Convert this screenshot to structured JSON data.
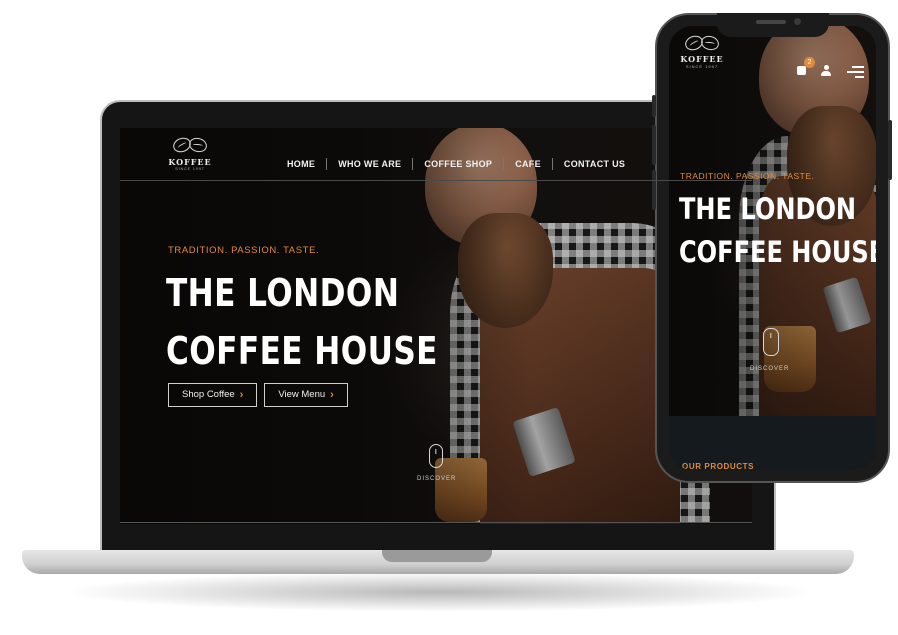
{
  "brand": {
    "name": "KOFFEE",
    "since": "SINCE 1997"
  },
  "laptop": {
    "nav": [
      "HOME",
      "WHO WE ARE",
      "COFFEE SHOP",
      "CAFE",
      "CONTACT US"
    ],
    "tagline": "TRADITION. PASSION. TASTE.",
    "title_line1": "THE LONDON",
    "title_line2": "COFFEE HOUSE",
    "buttons": {
      "shop": "Shop Coffee",
      "menu": "View Menu"
    },
    "discover": "DISCOVER"
  },
  "phone": {
    "cart_count": "2",
    "tagline": "TRADITION. PASSION. TASTE.",
    "title_line1": "THE LONDON",
    "title_line2": "COFFEE HOUSE",
    "discover": "DISCOVER",
    "section_heading": "OUR PRODUCTS"
  },
  "icons": {
    "logo": "coffee-beans-icon",
    "cart": "shopping-bag-icon",
    "account": "user-icon",
    "menu": "hamburger-menu-icon",
    "scroll": "mouse-scroll-icon",
    "chevron": "chevron-right-icon"
  },
  "colors": {
    "accent": "#e08a3e",
    "text": "#ffffff",
    "background": "#0b0a09"
  }
}
